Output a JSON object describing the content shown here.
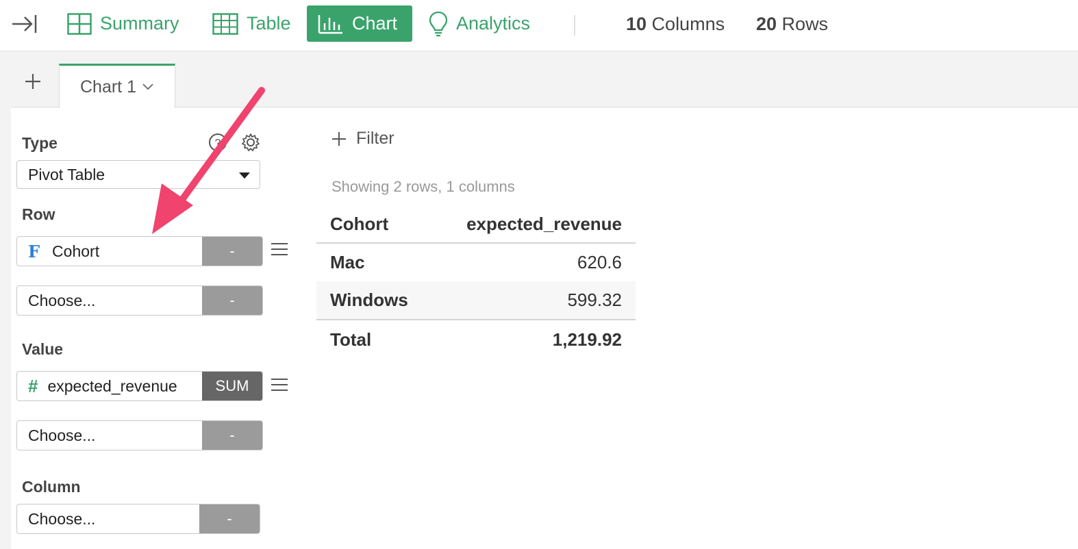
{
  "nav": {
    "items": [
      {
        "label": "Summary",
        "icon": "summary-grid-icon"
      },
      {
        "label": "Table",
        "icon": "table-icon"
      },
      {
        "label": "Chart",
        "icon": "bar-chart-icon",
        "active": true
      },
      {
        "label": "Analytics",
        "icon": "lightbulb-icon"
      }
    ],
    "columns_count": "10",
    "columns_label": " Columns",
    "rows_count": "20",
    "rows_label": " Rows"
  },
  "tabs": {
    "active_label": "Chart 1"
  },
  "config": {
    "type_label": "Type",
    "type_value": "Pivot Table",
    "row_label": "Row",
    "row_fields": [
      {
        "name": "Cohort",
        "badge": "-",
        "kind": "F"
      },
      {
        "name": "Choose...",
        "badge": "-"
      }
    ],
    "value_label": "Value",
    "value_fields": [
      {
        "name": "expected_revenue",
        "badge": "SUM",
        "kind": "#"
      },
      {
        "name": "Choose...",
        "badge": "-"
      }
    ],
    "column_label": "Column",
    "column_fields": [
      {
        "name": "Choose...",
        "badge": "-"
      }
    ]
  },
  "filter_label": "Filter",
  "showing_text": "Showing 2 rows, 1 columns",
  "pivot": {
    "headers": [
      "Cohort",
      "expected_revenue"
    ],
    "rows": [
      {
        "label": "Mac",
        "value": "620.6"
      },
      {
        "label": "Windows",
        "value": "599.32"
      }
    ],
    "total_label": "Total",
    "total_value": "1,219.92"
  },
  "colors": {
    "accent": "#3aa36b",
    "annotation_arrow": "#f0436e"
  }
}
